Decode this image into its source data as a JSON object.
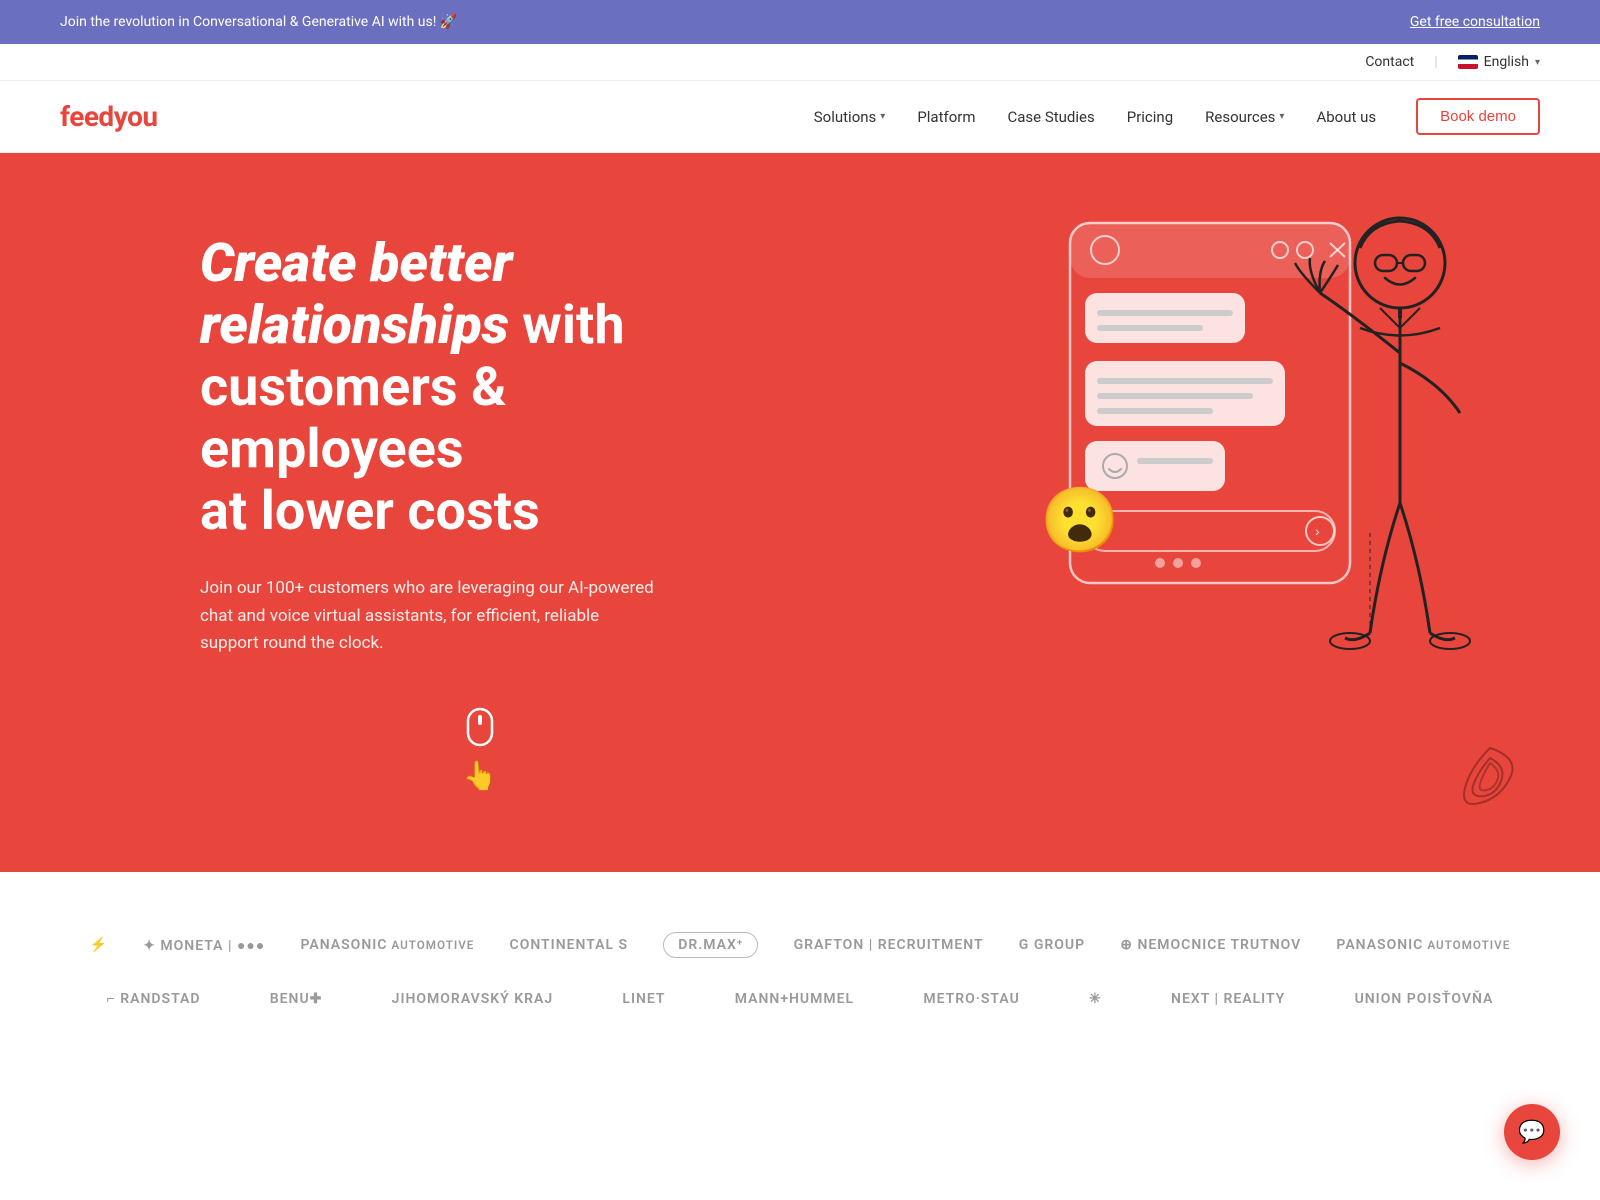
{
  "topBanner": {
    "text": "Join the revolution in Conversational & Generative AI with us! 🚀",
    "linkText": "Get free consultation",
    "linkUrl": "#"
  },
  "secondaryNav": {
    "contactLabel": "Contact",
    "languageLabel": "English",
    "languageChevron": "▾"
  },
  "mainNav": {
    "logoText": "feedyou",
    "links": [
      {
        "label": "Solutions",
        "hasDropdown": true
      },
      {
        "label": "Platform",
        "hasDropdown": false
      },
      {
        "label": "Case Studies",
        "hasDropdown": false
      },
      {
        "label": "Pricing",
        "hasDropdown": false
      },
      {
        "label": "Resources",
        "hasDropdown": true
      },
      {
        "label": "About us",
        "hasDropdown": false
      }
    ],
    "bookDemoLabel": "Book demo"
  },
  "hero": {
    "titleBold": "Create better relationships",
    "titleRest": " with customers & employees at lower costs",
    "subtitle": "Join our 100+ customers who are leveraging our AI-powered chat and voice virtual assistants, for efficient, reliable support round the clock.",
    "scrollIndicator": "☟",
    "wowEmoji": "😮",
    "scribbleSymbol": "✦"
  },
  "logos": {
    "row1": [
      {
        "text": "⚡",
        "label": ""
      },
      {
        "text": "MONETA | ●●●",
        "outlined": false
      },
      {
        "text": "Panasonic AUTOMOTIVE",
        "outlined": false
      },
      {
        "text": "Continental S",
        "outlined": false
      },
      {
        "text": "Dr.Max⁺",
        "outlined": true
      },
      {
        "text": "grafton | recruitment",
        "outlined": false
      },
      {
        "text": "G Group",
        "outlined": false
      },
      {
        "text": "⊕ Nemocnice Trutnov",
        "outlined": false
      },
      {
        "text": "Panasonic AUTOMOTIVE",
        "outlined": false
      }
    ],
    "row2": [
      {
        "text": "⌐ randstad",
        "outlined": false
      },
      {
        "text": "BENU✚",
        "outlined": false
      },
      {
        "text": "jihomoravský kraj",
        "outlined": false
      },
      {
        "text": "LINET",
        "outlined": false
      },
      {
        "text": "MANN+HUMMEL",
        "outlined": false
      },
      {
        "text": "metro·stau",
        "outlined": false
      },
      {
        "text": "✳",
        "outlined": false
      },
      {
        "text": "NEXT | REALITY",
        "outlined": false
      },
      {
        "text": "Union Poisťovňa",
        "outlined": false
      }
    ]
  },
  "chatWidget": {
    "icon": "💬"
  }
}
